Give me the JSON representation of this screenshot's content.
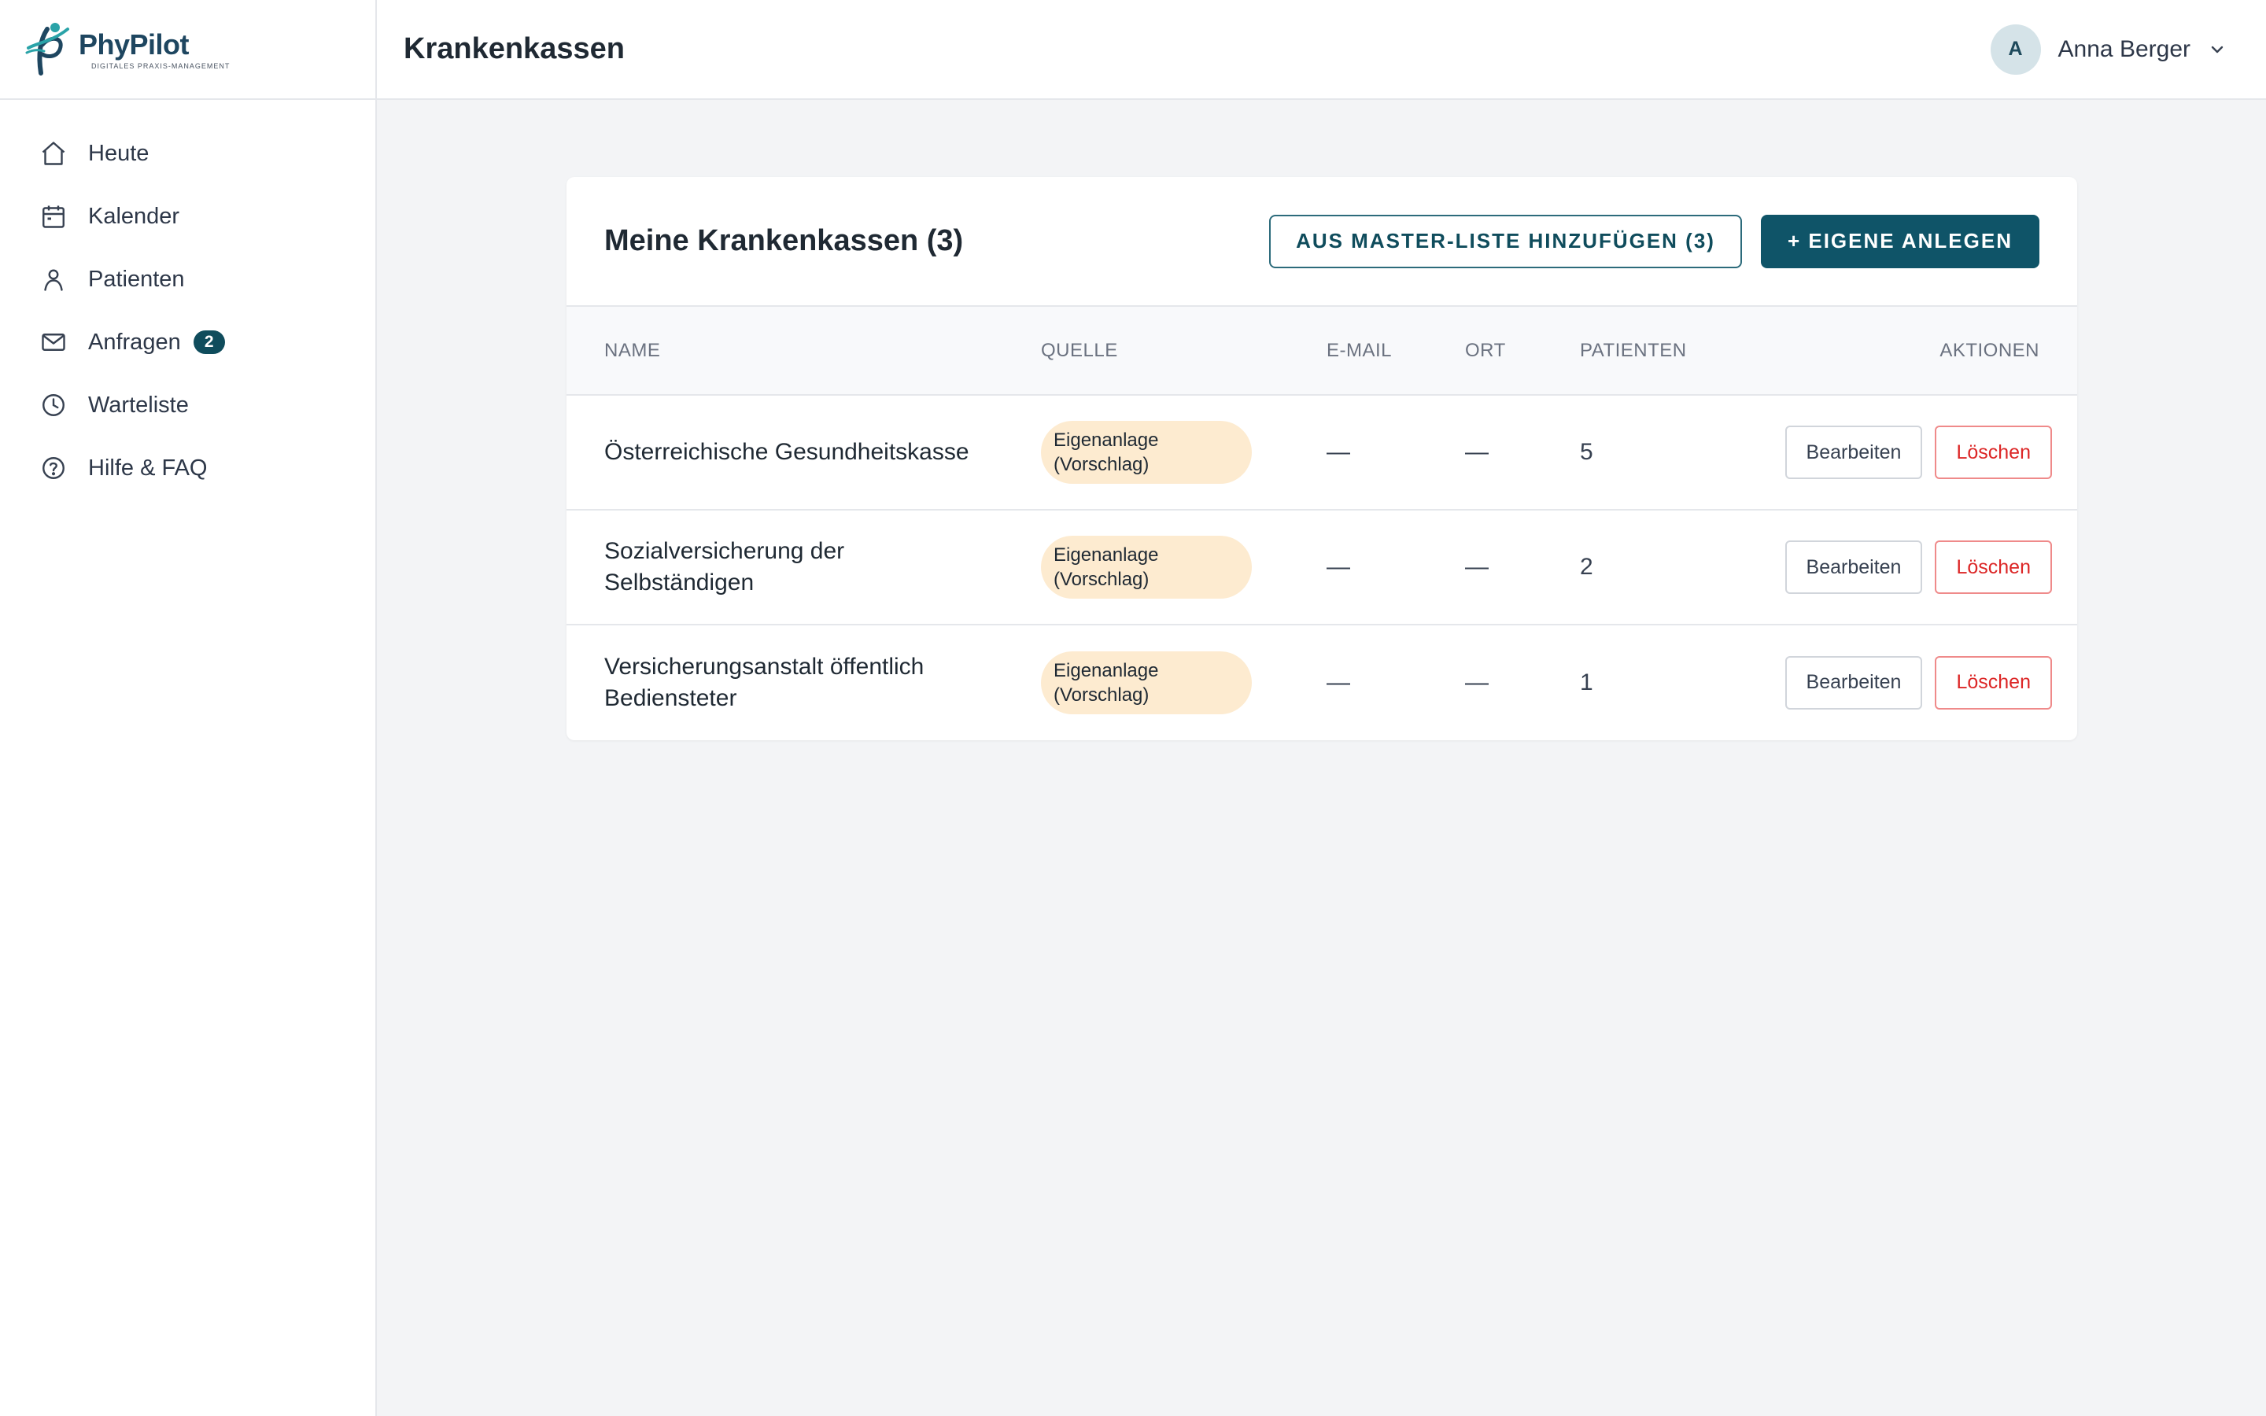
{
  "brand": {
    "name_part1": "Phy",
    "name_part2": "Pilot",
    "tagline": "DIGITALES PRAXIS-MANAGEMENT",
    "accent_color": "#0f5468"
  },
  "header": {
    "title": "Krankenkassen",
    "user": {
      "initial": "A",
      "name": "Anna Berger"
    }
  },
  "sidebar": {
    "items": [
      {
        "label": "Heute",
        "icon": "home-icon"
      },
      {
        "label": "Kalender",
        "icon": "calendar-icon"
      },
      {
        "label": "Patienten",
        "icon": "person-icon"
      },
      {
        "label": "Anfragen",
        "icon": "mail-icon",
        "badge": "2"
      },
      {
        "label": "Warteliste",
        "icon": "clock-icon"
      },
      {
        "label": "Hilfe & FAQ",
        "icon": "help-icon"
      }
    ]
  },
  "main": {
    "card_title": "Meine Krankenkassen (3)",
    "master_button": "AUS MASTER-LISTE HINZUFÜGEN (3)",
    "own_button": "+ EIGENE ANLEGEN",
    "columns": [
      "NAME",
      "QUELLE",
      "E-MAIL",
      "ORT",
      "PATIENTEN",
      "AKTIONEN"
    ],
    "rows": [
      {
        "name": "Österreichische Gesundheitskasse",
        "source": "Eigenanlage (Vorschlag)",
        "email": "—",
        "ort": "—",
        "patients": "5",
        "edit": "Bearbeiten",
        "delete": "Löschen"
      },
      {
        "name": "Sozialversicherung der Selbständigen",
        "source": "Eigenanlage (Vorschlag)",
        "email": "—",
        "ort": "—",
        "patients": "2",
        "edit": "Bearbeiten",
        "delete": "Löschen"
      },
      {
        "name": "Versicherungsanstalt öffentlich Bediensteter",
        "source": "Eigenanlage (Vorschlag)",
        "email": "—",
        "ort": "—",
        "patients": "1",
        "edit": "Bearbeiten",
        "delete": "Löschen"
      }
    ]
  }
}
